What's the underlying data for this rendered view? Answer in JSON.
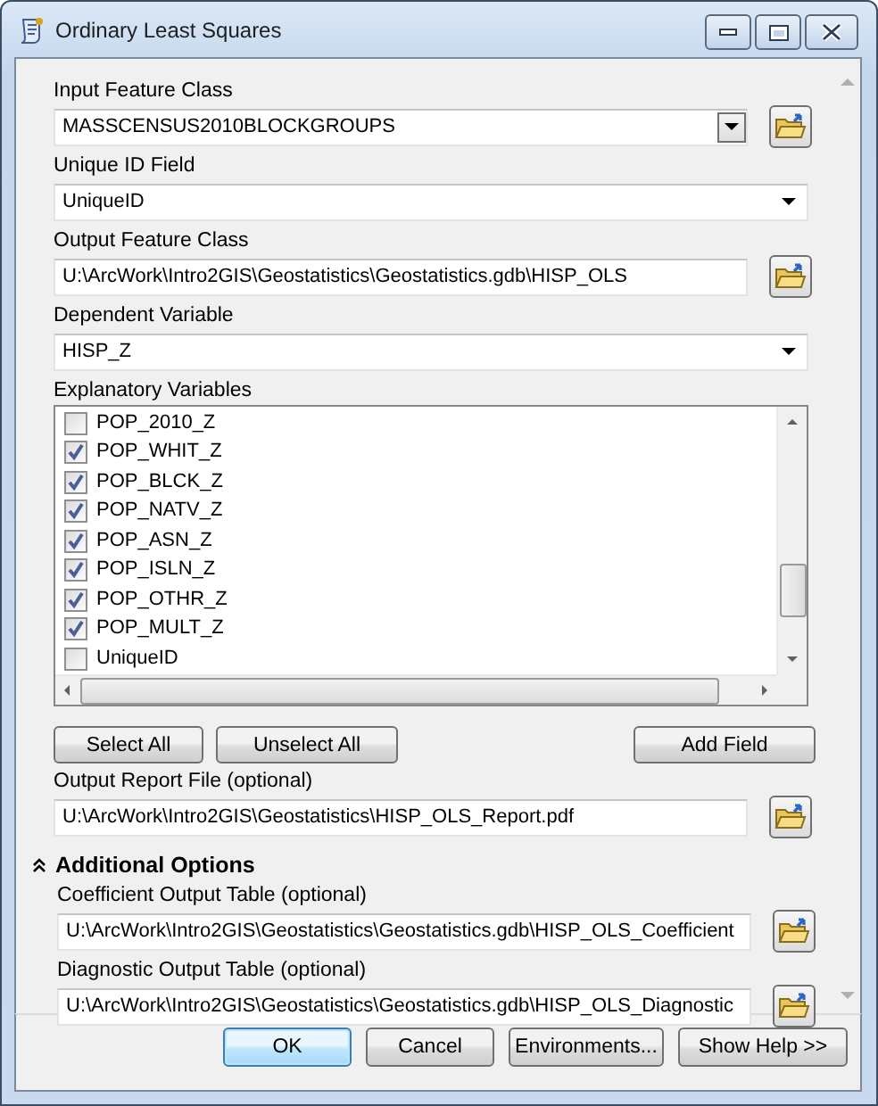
{
  "window": {
    "title": "Ordinary Least Squares"
  },
  "parameters": [
    {
      "kind": "combo",
      "label": "Input Feature Class",
      "value": "MASSCENSUS2010BLOCKGROUPS"
    },
    {
      "kind": "dropdown",
      "label": "Unique ID Field",
      "value": "UniqueID"
    },
    {
      "kind": "path",
      "label": "Output Feature Class",
      "value": "U:\\ArcWork\\Intro2GIS\\Geostatistics\\Geostatistics.gdb\\HISP_OLS"
    },
    {
      "kind": "dropdown",
      "label": "Dependent Variable",
      "value": "HISP_Z"
    },
    {
      "kind": "checklist",
      "label": "Explanatory Variables",
      "items": [
        {
          "label": "POP_2010_Z",
          "checked": false
        },
        {
          "label": "POP_WHIT_Z",
          "checked": true
        },
        {
          "label": "POP_BLCK_Z",
          "checked": true
        },
        {
          "label": "POP_NATV_Z",
          "checked": true
        },
        {
          "label": "POP_ASN_Z",
          "checked": true
        },
        {
          "label": "POP_ISLN_Z",
          "checked": true
        },
        {
          "label": "POP_OTHR_Z",
          "checked": true
        },
        {
          "label": "POP_MULT_Z",
          "checked": true
        },
        {
          "label": "UniqueID",
          "checked": false
        }
      ],
      "buttons": [
        "Select All",
        "Unselect All",
        "Add Field"
      ]
    },
    {
      "kind": "path",
      "label": "Output Report File (optional)",
      "value": "U:\\ArcWork\\Intro2GIS\\Geostatistics\\HISP_OLS_Report.pdf"
    }
  ],
  "additional_options": {
    "title": "Additional Options",
    "expanded": true,
    "parameters": [
      {
        "kind": "path",
        "label": "Coefficient Output Table (optional)",
        "value": "U:\\ArcWork\\Intro2GIS\\Geostatistics\\Geostatistics.gdb\\HISP_OLS_Coefficient"
      },
      {
        "kind": "path",
        "label": "Diagnostic Output Table (optional)",
        "value": "U:\\ArcWork\\Intro2GIS\\Geostatistics\\Geostatistics.gdb\\HISP_OLS_Diagnostic"
      }
    ]
  },
  "buttons": [
    {
      "label": "OK",
      "default": true
    },
    {
      "label": "Cancel",
      "default": false
    },
    {
      "label": "Environments...",
      "default": false
    },
    {
      "label": "Show Help >>",
      "default": false
    }
  ]
}
